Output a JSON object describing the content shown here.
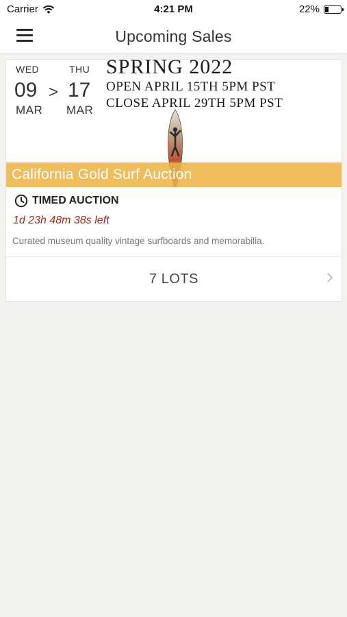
{
  "status_bar": {
    "carrier": "Carrier",
    "time": "4:21 PM",
    "battery": "22%",
    "battery_level": 0.22
  },
  "nav": {
    "title": "Upcoming Sales",
    "menu_icon": "hamburger-menu-icon"
  },
  "sale": {
    "start": {
      "dow": "WED",
      "day": "09",
      "month": "MAR"
    },
    "end": {
      "dow": "THU",
      "day": "17",
      "month": "MAR"
    },
    "arrow": ">",
    "poster": {
      "season": "SPRING 2022",
      "open_line": "OPEN APRIL 15TH 5PM PST",
      "close_line": "CLOSE APRIL 29TH 5PM PST"
    },
    "title": "California Gold Surf Auction",
    "title_strip_color": "#EDB446",
    "auction_type": "TIMED AUCTION",
    "time_left": "1d 23h 48m 38s left",
    "time_left_color": "#A02A1C",
    "description": "Curated museum quality vintage surfboards and memorabilia.",
    "lots_label": "7 LOTS"
  }
}
